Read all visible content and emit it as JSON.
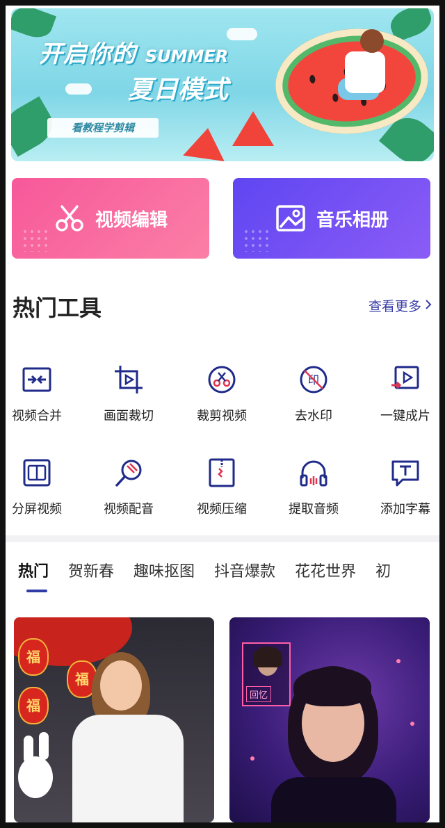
{
  "banner": {
    "line1_cn": "开启你的",
    "line1_en": "SUMMER",
    "line2": "夏日模式",
    "tag": "看教程学剪辑"
  },
  "actions": {
    "video_edit": "视频编辑",
    "music_album": "音乐相册"
  },
  "hot_tools": {
    "title": "热门工具",
    "more": "查看更多",
    "items": [
      {
        "label": "视频合并",
        "icon": "merge-icon"
      },
      {
        "label": "画面裁切",
        "icon": "crop-icon"
      },
      {
        "label": "裁剪视频",
        "icon": "scissors-icon"
      },
      {
        "label": "去水印",
        "icon": "watermark-icon"
      },
      {
        "label": "一键成片",
        "icon": "oneclick-icon"
      },
      {
        "label": "分屏视频",
        "icon": "splitscreen-icon"
      },
      {
        "label": "视频配音",
        "icon": "microphone-icon"
      },
      {
        "label": "视频压缩",
        "icon": "compress-icon"
      },
      {
        "label": "提取音频",
        "icon": "headphones-icon"
      },
      {
        "label": "添加字幕",
        "icon": "subtitle-icon"
      }
    ]
  },
  "tabs": [
    "热门",
    "贺新春",
    "趣味抠图",
    "抖音爆款",
    "花花世界",
    "初"
  ],
  "thumbs": {
    "left_lantern": "福",
    "right_label": "回忆"
  },
  "colors": {
    "accent": "#2f3ca8",
    "pink": "#f7589a",
    "purple": "#5f46f2"
  }
}
